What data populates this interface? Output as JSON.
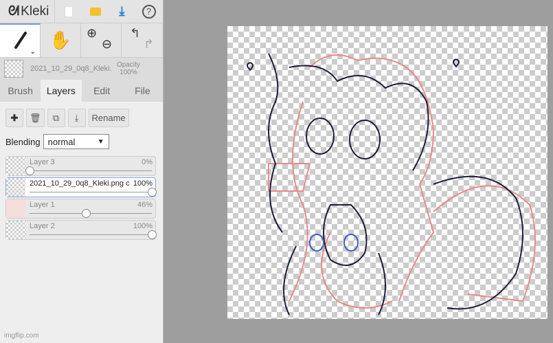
{
  "app": {
    "name": "Kleki",
    "watermark": "imgflip.com"
  },
  "file": {
    "name": "2021_10_29_0q8_Kleki.png",
    "opacity_label": "Opacity",
    "opacity": "100%"
  },
  "tabs": [
    "Brush",
    "Layers",
    "Edit",
    "File"
  ],
  "layer_panel": {
    "rename": "Rename",
    "blending_label": "Blending",
    "blending_value": "normal"
  },
  "layers": [
    {
      "name": "Layer 3",
      "opacity": "0%",
      "value": 0
    },
    {
      "name": "2021_10_29_0q8_Kleki.png c",
      "opacity": "100%",
      "value": 100
    },
    {
      "name": "Layer 1",
      "opacity": "46%",
      "value": 46
    },
    {
      "name": "Layer 2",
      "opacity": "100%",
      "value": 100
    }
  ],
  "colors": {
    "accent": "#1a7ad4",
    "sketch_pink": "#e88a8a",
    "sketch_navy": "#1c1c3a"
  }
}
